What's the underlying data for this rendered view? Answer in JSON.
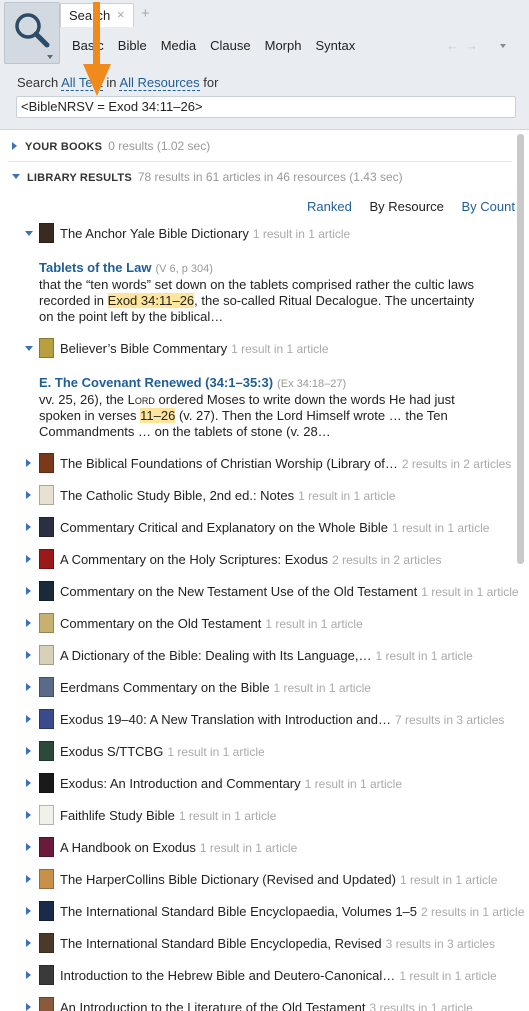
{
  "header": {
    "tab_label": "Search",
    "tab_close": "×",
    "tab_add": "+",
    "subtabs": [
      "Basic",
      "Bible",
      "Media",
      "Clause",
      "Morph",
      "Syntax"
    ],
    "nav_back": "←",
    "nav_forward": "→",
    "search_in_prefix": "Search",
    "search_in_scope": "All Text",
    "search_in_mid": "in",
    "search_in_resources": "All Resources",
    "search_in_suffix": "for",
    "query": "<BibleNRSV = Exod 34:11–26>"
  },
  "sections": {
    "your_books": {
      "label": "YOUR BOOKS",
      "meta": "0 results (1.02 sec)"
    },
    "library_results": {
      "label": "LIBRARY RESULTS",
      "meta": "78 results in 61 articles in 46 resources (1.43 sec)"
    }
  },
  "sort": {
    "ranked": "Ranked",
    "by_resource": "By Resource",
    "by_count": "By Count"
  },
  "expanded": [
    {
      "title": "The Anchor Yale Bible Dictionary",
      "count": "1 result in 1 article",
      "cover_color": "#3a2a20",
      "snippet_head": "Tablets of the Law",
      "snippet_ref": "(V 6, p 304)",
      "snippet_pre": "that the “ten words” set down on the tablets comprised rather the cultic laws recorded in ",
      "snippet_hl": "Exod 34:11–26",
      "snippet_post": ", the so-called Ritual Decalogue. The uncertainty on the point left by the biblical…"
    },
    {
      "title": "Believer’s Bible Commentary",
      "count": "1 result in 1 article",
      "cover_color": "#b8a040",
      "snippet_head": "E. The Covenant Renewed (34:1–35:3)",
      "snippet_ref": "(Ex 34:18–27)",
      "snippet_pre": "vv. 25, 26), the ",
      "snippet_lord": "Lord",
      "snippet_mid": " ordered Moses to write down the words He had just spoken in verses ",
      "snippet_hl": "11–26",
      "snippet_post": " (v. 27). Then the Lord Himself wrote … the Ten Commandments … on the tablets of stone (v. 28…"
    }
  ],
  "resources": [
    {
      "title": "The Biblical Foundations of Christian Worship (Library of…",
      "count": "2 results in 2 articles",
      "cover_color": "#7a3a1a"
    },
    {
      "title": "The Catholic Study Bible, 2nd ed.: Notes",
      "count": "1 result in 1 article",
      "cover_color": "#e8e0d0"
    },
    {
      "title": "Commentary Critical and Explanatory on the Whole Bible",
      "count": "1 result in 1 article",
      "cover_color": "#2a3040"
    },
    {
      "title": "A Commentary on the Holy Scriptures: Exodus",
      "count": "2 results in 2 articles",
      "cover_color": "#9a1a1a"
    },
    {
      "title": "Commentary on the New Testament Use of the Old Testament",
      "count": "1 result in 1 article",
      "cover_color": "#1a2a3a"
    },
    {
      "title": "Commentary on the Old Testament",
      "count": "1 result in 1 article",
      "cover_color": "#c8b070"
    },
    {
      "title": "A Dictionary of the Bible: Dealing with Its Language,…",
      "count": "1 result in 1 article",
      "cover_color": "#d8d0b8"
    },
    {
      "title": "Eerdmans Commentary on the Bible",
      "count": "1 result in 1 article",
      "cover_color": "#5a6a8a"
    },
    {
      "title": "Exodus 19–40: A New Translation with Introduction and…",
      "count": "7 results in 3 articles",
      "cover_color": "#3a4a8a"
    },
    {
      "title": "Exodus S/TTCBG",
      "count": "1 result in 1 article",
      "cover_color": "#2a4a3a"
    },
    {
      "title": "Exodus: An Introduction and Commentary",
      "count": "1 result in 1 article",
      "cover_color": "#1a1a1a"
    },
    {
      "title": "Faithlife Study Bible",
      "count": "1 result in 1 article",
      "cover_color": "#eef2e8"
    },
    {
      "title": "A Handbook on Exodus",
      "count": "1 result in 1 article",
      "cover_color": "#6a1a3a"
    },
    {
      "title": "The HarperCollins Bible Dictionary (Revised and Updated)",
      "count": "1 result in 1 article",
      "cover_color": "#c89048"
    },
    {
      "title": "The International Standard Bible Encyclopaedia, Volumes 1–5",
      "count": "2 results in 1 article",
      "cover_color": "#1a2a4a"
    },
    {
      "title": "The International Standard Bible Encyclopedia, Revised",
      "count": "3 results in 3 articles",
      "cover_color": "#4a3a2a"
    },
    {
      "title": "Introduction to the Hebrew Bible and Deutero-Canonical…",
      "count": "1 result in 1 article",
      "cover_color": "#3a3a3a"
    },
    {
      "title": "An Introduction to the Literature of the Old Testament",
      "count": "3 results in 1 article",
      "cover_color": "#8a5a3a"
    }
  ]
}
